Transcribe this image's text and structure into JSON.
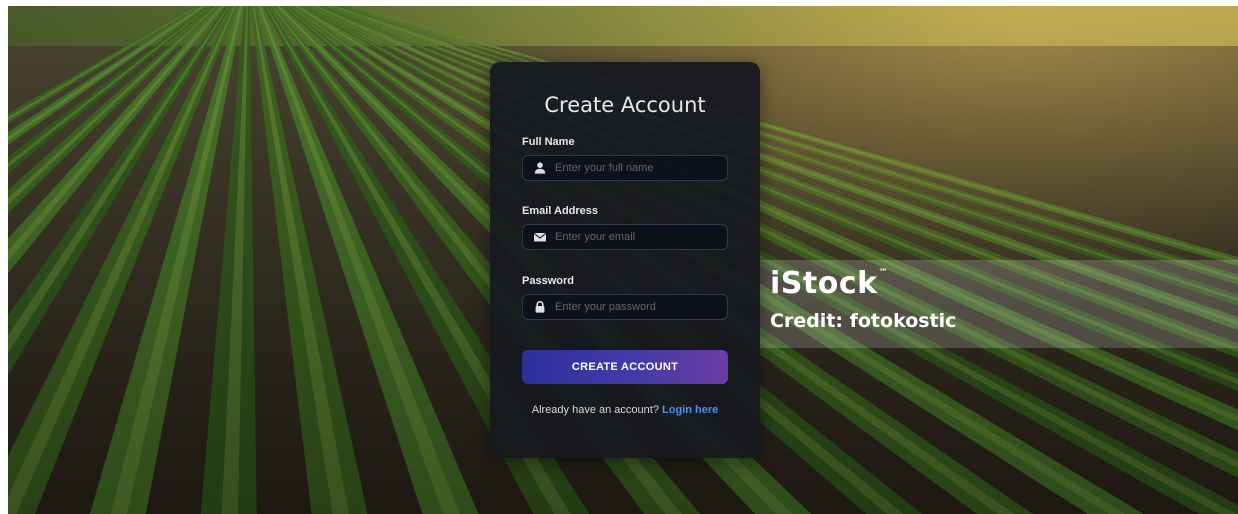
{
  "form": {
    "title": "Create Account",
    "full_name": {
      "label": "Full Name",
      "placeholder": "Enter your full name",
      "icon": "user-icon"
    },
    "email": {
      "label": "Email Address",
      "placeholder": "Enter your email",
      "icon": "envelope-icon"
    },
    "password": {
      "label": "Password",
      "placeholder": "Enter your password",
      "icon": "lock-icon"
    },
    "submit_label": "CREATE ACCOUNT",
    "login_prompt": "Already have an account?",
    "login_link": "Login here"
  },
  "watermark": {
    "brand": "iStock",
    "tm": "™",
    "credit": "Credit: fotokostic"
  },
  "colors": {
    "card_bg": "#16181e",
    "accent_start": "#2d2f9a",
    "accent_end": "#6c3da1",
    "link": "#4f8ff0"
  }
}
